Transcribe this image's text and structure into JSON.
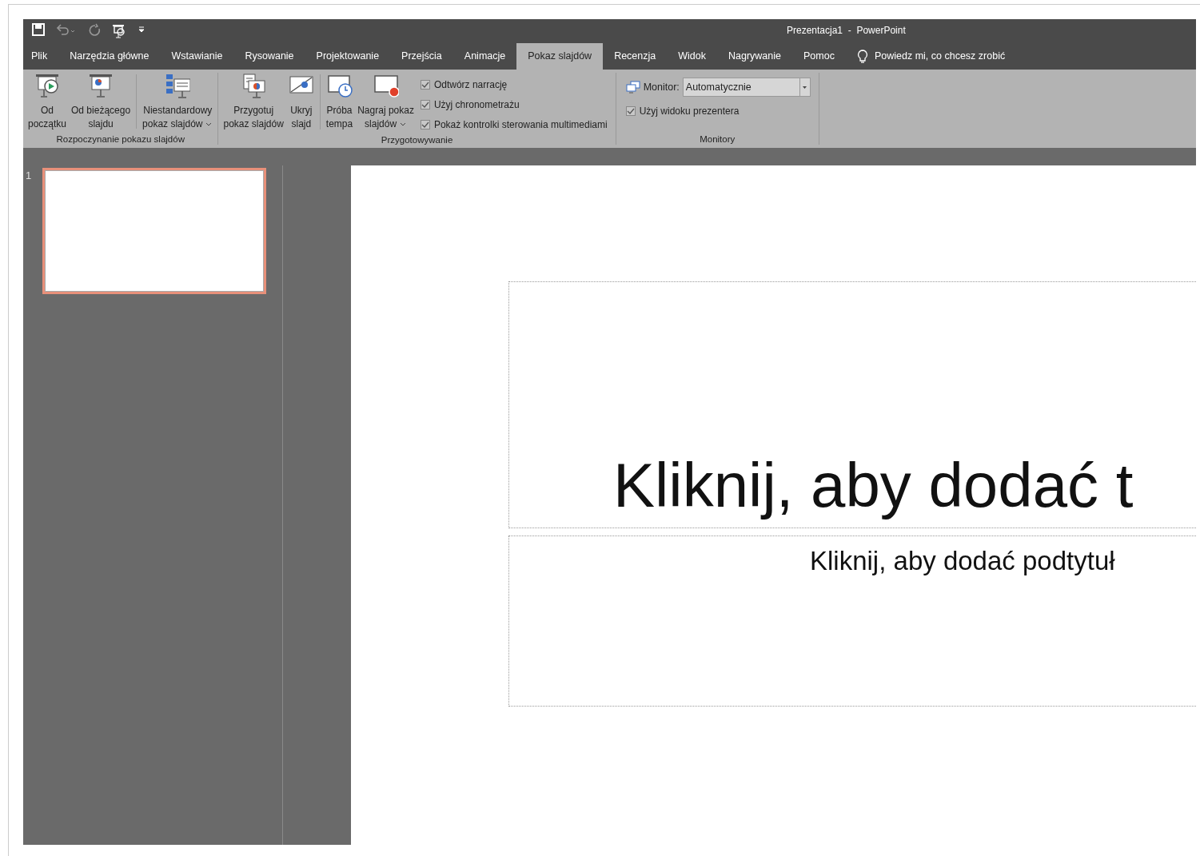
{
  "window": {
    "title": "Prezentacja1  -  PowerPoint"
  },
  "tabs": [
    {
      "label": "Plik",
      "selected": false
    },
    {
      "label": "Narzędzia główne",
      "selected": false
    },
    {
      "label": "Wstawianie",
      "selected": false
    },
    {
      "label": "Rysowanie",
      "selected": false
    },
    {
      "label": "Projektowanie",
      "selected": false
    },
    {
      "label": "Przejścia",
      "selected": false
    },
    {
      "label": "Animacje",
      "selected": false
    },
    {
      "label": "Pokaz slajdów",
      "selected": true
    },
    {
      "label": "Recenzja",
      "selected": false
    },
    {
      "label": "Widok",
      "selected": false
    },
    {
      "label": "Nagrywanie",
      "selected": false
    },
    {
      "label": "Pomoc",
      "selected": false
    }
  ],
  "tell_me": {
    "text": "Powiedz mi, co chcesz zrobić"
  },
  "ribbon": {
    "groups": [
      {
        "label": "Rozpoczynanie pokazu slajdów",
        "items": [
          {
            "kind": "button",
            "lines": [
              "Od",
              "początku"
            ],
            "dropdown": false
          },
          {
            "kind": "button",
            "lines": [
              "Od bieżącego",
              "slajdu"
            ],
            "dropdown": false
          },
          {
            "kind": "separator"
          },
          {
            "kind": "button",
            "lines": [
              "Niestandardowy",
              "pokaz slajdów"
            ],
            "dropdown": true
          }
        ]
      },
      {
        "label": "Przygotowywanie",
        "items": [
          {
            "kind": "button",
            "lines": [
              "Przygotuj",
              "pokaz slajdów"
            ],
            "dropdown": false
          },
          {
            "kind": "button",
            "lines": [
              "Ukryj",
              "slajd"
            ],
            "dropdown": false
          },
          {
            "kind": "separator"
          },
          {
            "kind": "button",
            "lines": [
              "Próba",
              "tempa"
            ],
            "dropdown": false
          },
          {
            "kind": "button",
            "lines": [
              "Nagraj pokaz",
              "slajdów"
            ],
            "dropdown": true
          },
          {
            "kind": "checks",
            "checks": [
              {
                "label": "Odtwórz narrację",
                "checked": true
              },
              {
                "label": "Użyj chronometrażu",
                "checked": true
              },
              {
                "label": "Pokaż kontrolki sterowania multimediami",
                "checked": true
              }
            ]
          }
        ]
      },
      {
        "label": "Monitory",
        "items": [
          {
            "kind": "monitor",
            "label": "Monitor:",
            "value": "Automatycznie",
            "checks": [
              {
                "label": "Użyj widoku prezentera",
                "checked": true
              }
            ]
          }
        ]
      }
    ]
  },
  "thumbnails": [
    {
      "number": "1",
      "selected": true
    }
  ],
  "slide": {
    "title": "Kliknij, aby dodać t",
    "subtitle": "Kliknij, aby dodać podtytuł"
  }
}
